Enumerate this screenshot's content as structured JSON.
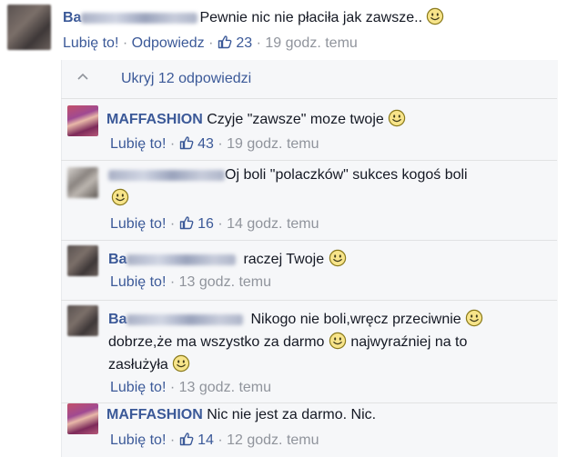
{
  "main_comment": {
    "author_prefix": "Ba",
    "text": "Pewnie nic nie płaciła jak zawsze..",
    "like_label": "Lubię to!",
    "reply_label": "Odpowiedz",
    "likes": "23",
    "time": "19 godz. temu"
  },
  "hide_replies_label": "Ukryj 12 odpowiedzi",
  "replies": [
    {
      "author": "MAFFASHION",
      "text": "Czyje \"zawsze\" moze twoje",
      "like_label": "Lubię to!",
      "likes": "43",
      "time": "19 godz. temu"
    },
    {
      "author": "",
      "text": "Oj boli \"polaczków\" sukces kogoś boli",
      "like_label": "Lubię to!",
      "likes": "16",
      "time": "14 godz. temu"
    },
    {
      "author_prefix": "Ba",
      "text": "raczej Twoje",
      "like_label": "Lubię to!",
      "time": "13 godz. temu"
    },
    {
      "author_prefix": "Ba",
      "text_line1": "Nikogo nie boli,wręcz przeciwnie",
      "text_line2a": "dobrze,że ma wszystko za darmo",
      "text_line2b": "najwyraźniej na to",
      "text_line3": "zasłużyła",
      "like_label": "Lubię to!",
      "time": "13 godz. temu"
    },
    {
      "author": "MAFFASHION",
      "text": "Nic nie jest za darmo. Nic.",
      "like_label": "Lubię to!",
      "likes": "14",
      "time": "12 godz. temu"
    }
  ],
  "colors": {
    "link": "#3b5998",
    "meta": "#90949c",
    "text": "#141823",
    "reply_bg": "#f6f7f9"
  }
}
